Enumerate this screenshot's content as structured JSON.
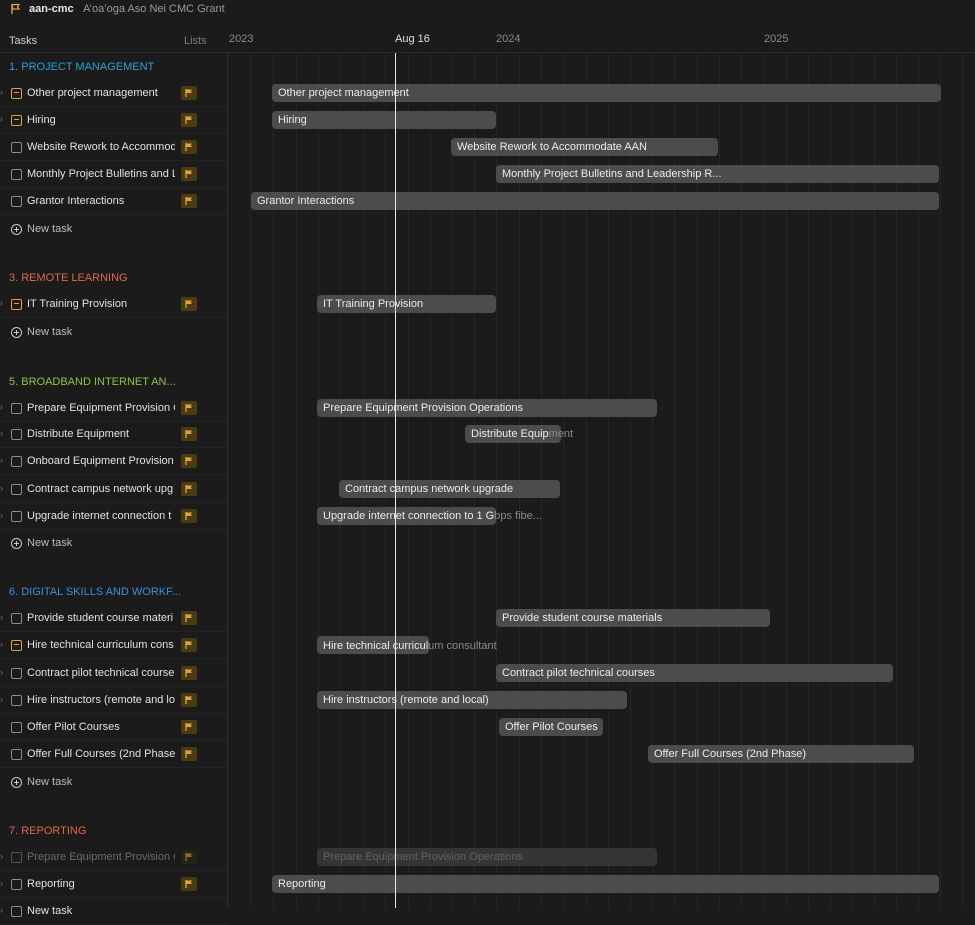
{
  "project": {
    "code": "aan-cmc",
    "title": "A’oa’oga Aso Nei CMC Grant"
  },
  "header": {
    "tasks_label": "Tasks",
    "lists_label": "Lists"
  },
  "timeline": {
    "year_labels": [
      "2023",
      "2024",
      "2025"
    ],
    "today_label": "Aug 16"
  },
  "sections": {
    "s1": {
      "label": "1. PROJECT MANAGEMENT",
      "color": "#29a3d6"
    },
    "s3": {
      "label": "3. REMOTE LEARNING",
      "color": "#e0694a"
    },
    "s5": {
      "label": "5. BROADBAND INTERNET AN...",
      "color": "#8cc63f"
    },
    "s6": {
      "label": "6. DIGITAL SKILLS AND WORKF...",
      "color": "#3d8fe0"
    },
    "s7": {
      "label": "7. REPORTING",
      "color": "#e0694a"
    }
  },
  "tasks": {
    "t1": {
      "label": "Other project management",
      "bar": "Other project management"
    },
    "t2": {
      "label": "Hiring",
      "bar": "Hiring"
    },
    "t3": {
      "label": "Website Rework to Accommod",
      "bar": "Website Rework to Accommodate AAN"
    },
    "t4": {
      "label": "Monthly Project Bulletins and L",
      "bar": "Monthly Project Bulletins and Leadership R..."
    },
    "t5": {
      "label": "Grantor Interactions",
      "bar": "Grantor Interactions"
    },
    "t6": {
      "label": "IT Training Provision",
      "bar": "IT Training Provision"
    },
    "t7": {
      "label": "Prepare Equipment Provision C",
      "bar": "Prepare Equipment Provision Operations"
    },
    "t8": {
      "label": "Distribute Equipment",
      "bar_in": "Distribute Equip",
      "bar_over": "ment"
    },
    "t9": {
      "label": "Onboard Equipment Provision"
    },
    "t10": {
      "label": "Contract campus network upg",
      "bar": "Contract campus network upgrade"
    },
    "t11": {
      "label": "Upgrade internet connection t",
      "bar_in": "Upgrade internet connection to 1 G",
      "bar_over": "bps fibe..."
    },
    "t12": {
      "label": "Provide student course materi",
      "bar": "Provide student course materials"
    },
    "t13": {
      "label": "Hire technical curriculum cons",
      "bar_in": "Hire technical curricul",
      "bar_over": "um consultant"
    },
    "t14": {
      "label": "Contract pilot technical course",
      "bar": "Contract pilot technical courses"
    },
    "t15": {
      "label": "Hire instructors (remote and lo",
      "bar": "Hire instructors (remote and local)"
    },
    "t16": {
      "label": "Offer Pilot Courses",
      "bar": "Offer Pilot Courses"
    },
    "t17": {
      "label": "Offer Full Courses (2nd Phase)",
      "bar": "Offer Full Courses (2nd Phase)"
    },
    "t18": {
      "label": "Prepare Equipment Provision C",
      "bar": "Prepare Equipment Provision Operations"
    },
    "t19": {
      "label": "Reporting",
      "bar": "Reporting"
    },
    "t20": {
      "label": "New task"
    }
  },
  "new_task_label": "New task",
  "colors": {
    "flag": "#e2a23b",
    "bar": "#4c4c4c",
    "today": "#e8e8e8"
  }
}
